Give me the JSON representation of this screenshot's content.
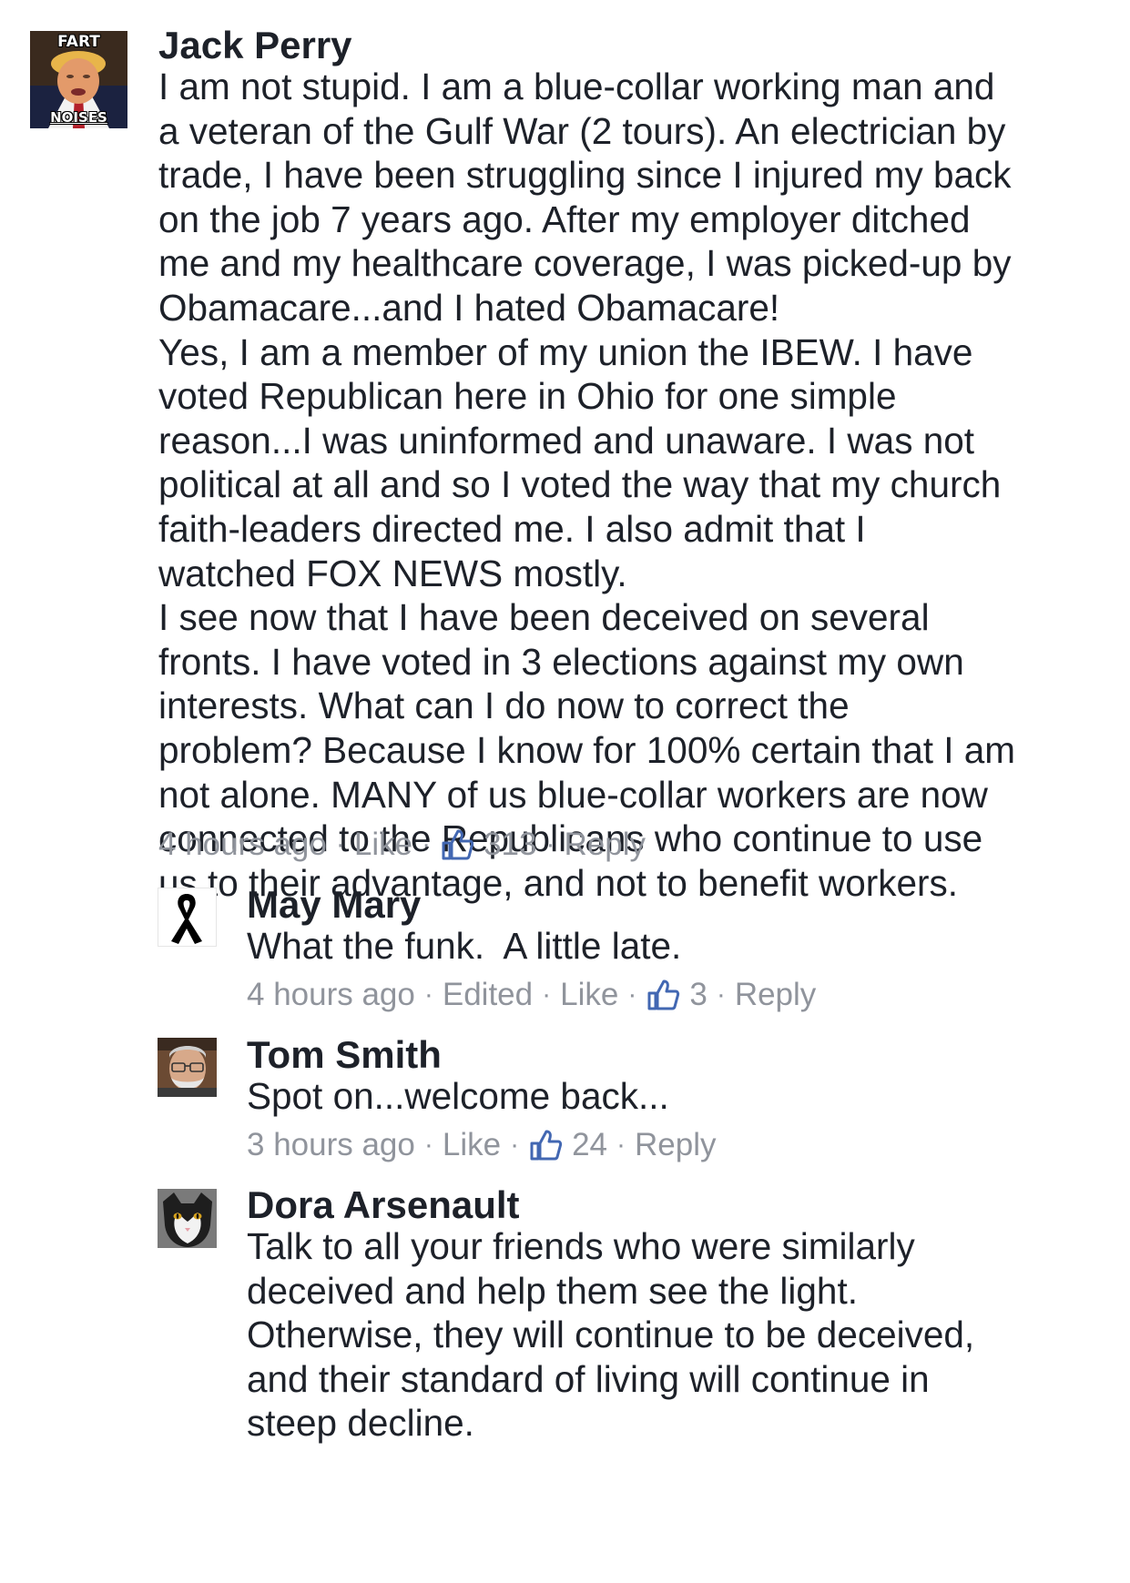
{
  "comments": [
    {
      "author": "Jack Perry",
      "avatar": {
        "icon": "trump-meme-avatar-icon",
        "caption_top": "FART",
        "caption_bottom": "NOISES"
      },
      "lines": [
        "I am not stupid. I am a blue-collar working man and",
        "a veteran of the Gulf War (2 tours). An electrician by",
        "trade, I have been struggling since I injured my back",
        "on the job 7 years ago. After my employer ditched",
        "me and my healthcare coverage, I was picked-up by",
        "Obamacare...and I hated Obamacare!",
        "Yes, I am a member of my union the IBEW. I have",
        "voted Republican here in Ohio for one simple",
        "reason...I was uninformed and unaware. I was not",
        "political at all and so I voted the way that my church",
        "faith-leaders directed me. I also admit that I",
        "watched FOX NEWS mostly.",
        "I see now that I have been deceived on several",
        "fronts. I have voted in 3 elections against my own",
        "interests. What can I do now to correct the",
        "problem? Because I know for 100% certain that I am",
        "not alone. MANY of us blue-collar workers are now",
        "connected to the Republicans who continue to use",
        "us to their advantage, and not to benefit workers."
      ],
      "time": "4 hours ago",
      "edited": "",
      "like_label": "Like",
      "like_count": "313",
      "reply_label": "Reply"
    },
    {
      "author": "May Mary",
      "avatar": {
        "icon": "black-ribbon-icon"
      },
      "lines": [
        "What the funk.  A little late."
      ],
      "time": "4 hours ago",
      "edited": "Edited",
      "like_label": "Like",
      "like_count": "3",
      "reply_label": "Reply"
    },
    {
      "author": "Tom Smith",
      "avatar": {
        "icon": "man-with-glasses-avatar-icon"
      },
      "lines": [
        "Spot on...welcome back..."
      ],
      "time": "3 hours ago",
      "edited": "",
      "like_label": "Like",
      "like_count": "24",
      "reply_label": "Reply"
    },
    {
      "author": "Dora Arsenault",
      "avatar": {
        "icon": "cat-avatar-icon"
      },
      "lines": [
        "Talk to all your friends who were similarly",
        "deceived and help them see the light.",
        "Otherwise, they will continue to be deceived,",
        "and their standard of living will continue in",
        "steep decline."
      ]
    }
  ],
  "colors": {
    "text": "#1d2129",
    "meta": "#90949c",
    "like_icon": "#4267b2"
  }
}
